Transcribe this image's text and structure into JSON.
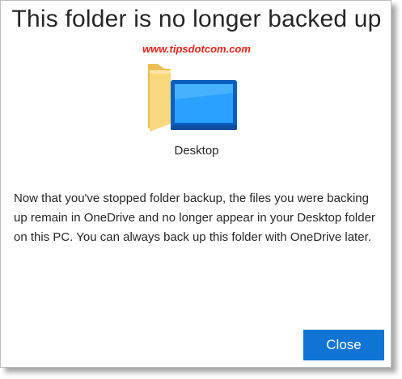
{
  "dialog": {
    "title": "This folder is no longer backed up",
    "watermark": "www.tipsdotcom.com",
    "folder": {
      "icon": "desktop-folder-icon",
      "label": "Desktop"
    },
    "message": "Now that you've stopped folder backup, the files you were backing up remain in OneDrive and no longer appear in your Desktop folder on this PC. You can always back up this folder with OneDrive later.",
    "close_label": "Close"
  },
  "colors": {
    "accent": "#0f74d3",
    "watermark": "#e2231a",
    "folder_yellow": "#f5d57a",
    "monitor_blue": "#1e90ff"
  }
}
